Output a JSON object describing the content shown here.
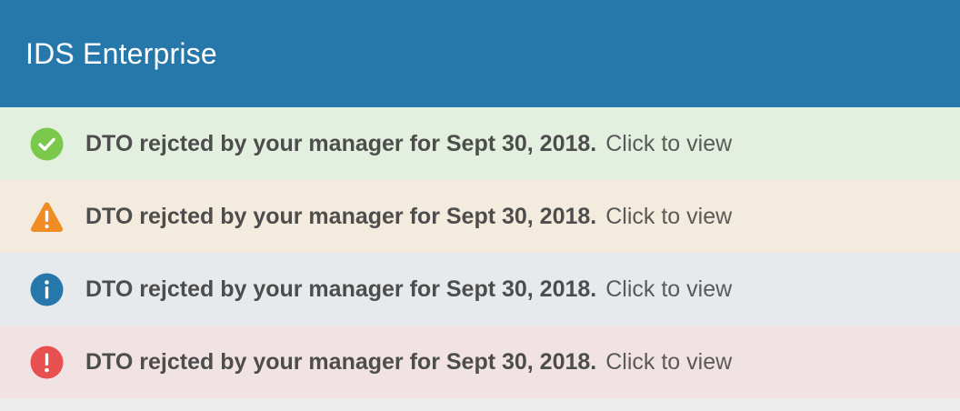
{
  "header": {
    "title": "IDS Enterprise"
  },
  "notifications": [
    {
      "type": "success",
      "icon": "checkmark-circle-icon",
      "background": "#e4f0df",
      "icon_color": "#7ac94d",
      "message": "DTO rejcted by your manager for Sept 30, 2018.",
      "link": "Click to view"
    },
    {
      "type": "warning",
      "icon": "warning-triangle-icon",
      "background": "#f3ebdd",
      "icon_color": "#f08c25",
      "message": "DTO rejcted by your manager for Sept 30, 2018.",
      "link": "Click to view"
    },
    {
      "type": "info",
      "icon": "info-circle-icon",
      "background": "#e7eaec",
      "icon_color": "#2578a9",
      "message": "DTO rejcted by your manager for Sept 30, 2018.",
      "link": "Click to view"
    },
    {
      "type": "error",
      "icon": "error-circle-icon",
      "background": "#f1e3e3",
      "icon_color": "#e84f4f",
      "message": "DTO rejcted by your manager for Sept 30, 2018.",
      "link": "Click to view"
    }
  ],
  "colors": {
    "header_bg": "#2578a9",
    "header_text": "#ffffff"
  }
}
